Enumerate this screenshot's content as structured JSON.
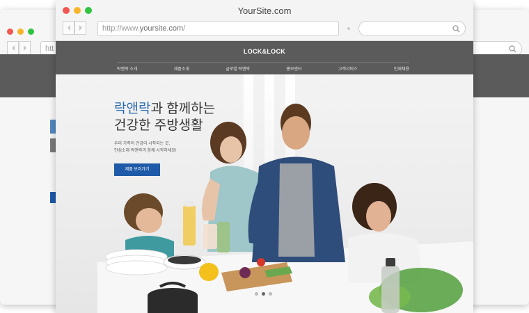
{
  "browser": {
    "title": "YourSite.com",
    "url_prefix": "http://www.",
    "url_domain": "yoursite.com",
    "url_suffix": "/",
    "background_url_fragment": "htt"
  },
  "site": {
    "logo": "LOCK&LOCK",
    "menu": [
      "락앤락 소개",
      "제품소개",
      "글로벌 락앤락",
      "홍보센터",
      "고객서비스",
      "인재채용"
    ]
  },
  "hero": {
    "title_accent": "락앤락",
    "title_rest": "과 함께하는",
    "title_line2": "건강한 주방생활",
    "desc_line1": "우리 가족의 건강이 시작되는 곳,",
    "desc_line2": "안심소재 락앤락과 함께 시작하세요!",
    "cta": "제품 보러가기",
    "slides": 3,
    "active_slide": 2
  },
  "colors": {
    "accent": "#2b6cb0",
    "cta": "#1e5aa8",
    "header": "#5b5b5b"
  },
  "icons": [
    "back-arrow-icon",
    "forward-arrow-icon",
    "search-icon"
  ]
}
